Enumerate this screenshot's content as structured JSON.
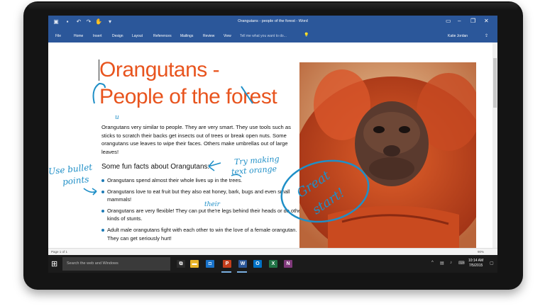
{
  "window": {
    "title": "Orangutans - people of the forest - Word",
    "quick_access": [
      "save-icon",
      "undo-icon",
      "redo-icon",
      "touch-mode-icon",
      "customize-icon"
    ],
    "controls": [
      "minimize",
      "restore",
      "close"
    ]
  },
  "ribbon": {
    "tabs": [
      "File",
      "Home",
      "Insert",
      "Design",
      "Layout",
      "References",
      "Mailings",
      "Review",
      "View"
    ],
    "tell_me_placeholder": "Tell me what you want to do...",
    "user": "Katie Jordan",
    "share_icon": "share-icon"
  },
  "document": {
    "title_line1": "Orangutans -",
    "title_line2": "People of the forest",
    "intro": "Orangutans very similar to people. They are very smart. They use tools such as sticks to scratch their backs get insects out of trees or break open nuts. Some orangutans use leaves to wipe their faces. Others make umbrellas out of large leaves!",
    "subheading": "Some fun facts about Orangutans:",
    "bullets": [
      "Orangutans spend almost their whole lives up in the trees.",
      "Orangutans love to eat fruit but they also eat honey, bark, bugs and even small mammals!",
      "Orangutans are very flexible! They can put the're legs behind their heads or do other kinds of stunts.",
      "Adult male orangutans fight with each other to win the love of a female orangutan. They can get seriously hurt!"
    ]
  },
  "ink": {
    "note_bullets_1": "Use bullet",
    "note_bullets_2": "points",
    "note_orange_1": "Try making",
    "note_orange_2": "text orange",
    "note_great_1": "Great",
    "note_great_2": "start!",
    "note_their": "their",
    "note_u": "u",
    "color": "#1f8fc7"
  },
  "statusbar": {
    "page": "Page 1 of 1",
    "zoom": "90%"
  },
  "taskbar": {
    "search_placeholder": "Search the web and Windows",
    "apps": [
      {
        "name": "task-view",
        "label": "⧉",
        "color": "#1b1b1b"
      },
      {
        "name": "file-explorer",
        "label": "▬",
        "color": "#e8b429"
      },
      {
        "name": "store",
        "label": "◘",
        "color": "#1a73c9"
      },
      {
        "name": "powerpoint",
        "label": "P",
        "color": "#c43e1c"
      },
      {
        "name": "word",
        "label": "W",
        "color": "#2b579a"
      },
      {
        "name": "outlook",
        "label": "O",
        "color": "#0072c6"
      },
      {
        "name": "excel",
        "label": "X",
        "color": "#217346"
      },
      {
        "name": "onenote",
        "label": "N",
        "color": "#80397b"
      }
    ],
    "time": "10:14 AM",
    "date": "7/5/2015"
  },
  "colors": {
    "accent": "#2b579a",
    "title_orange": "#e8541e",
    "ink_blue": "#1f8fc7"
  }
}
